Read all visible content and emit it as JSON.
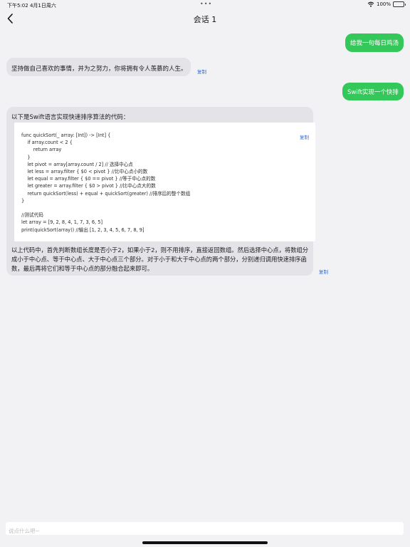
{
  "status_bar": {
    "time": "下午5:02   4月1日周六",
    "battery": "100%"
  },
  "nav": {
    "title": "会话 1"
  },
  "messages": {
    "m1": {
      "text": "给我一句每日鸡汤"
    },
    "m2": {
      "text": "坚持做自己喜欢的事情，并为之努力，你将拥有令人羡慕的人生。",
      "copy": "复制"
    },
    "m3": {
      "text": "Swift实现一个快排"
    },
    "m4": {
      "intro": "以下是Swift语言实现快速排序算法的代码：",
      "code_copy": "复制",
      "code": "func quickSort(_ array: [Int]) -> [Int] {\n    if array.count < 2 {\n        return array\n    }\n    let pivot = array[array.count / 2] // 选择中心点\n    let less = array.filter { $0 < pivot } //比中心点小的数\n    let equal = array.filter { $0 == pivot } //等于中心点的数\n    let greater = array.filter { $0 > pivot } //比中心点大的数\n    return quickSort(less) + equal + quickSort(greater) //排序后的整个数组\n}\n\n//测试代码\nlet array = [9, 2, 8, 4, 1, 7, 3, 6, 5]\nprint(quickSort(array)) //输出 [1, 2, 3, 4, 5, 6, 7, 8, 9]",
      "outro": "以上代码中，首先判断数组长度是否小于2，如果小于2，则不用排序，直接返回数组。然后选择中心点，将数组分成小于中心点、等于中心点、大于中心点三个部分。对于小于和大于中心点的两个部分，分别递归调用快速排序函数，最后再将它们和等于中心点的部分融合起来即可。",
      "copy": "复制"
    }
  },
  "input": {
    "placeholder": "说点什么吧~"
  },
  "colors": {
    "user_bubble": "#34c759",
    "bot_bubble": "#e4e4e8",
    "link": "#2f6fd8"
  },
  "icons": {
    "back": "chevron-left-icon",
    "wifi": "wifi-icon",
    "battery": "battery-icon"
  }
}
